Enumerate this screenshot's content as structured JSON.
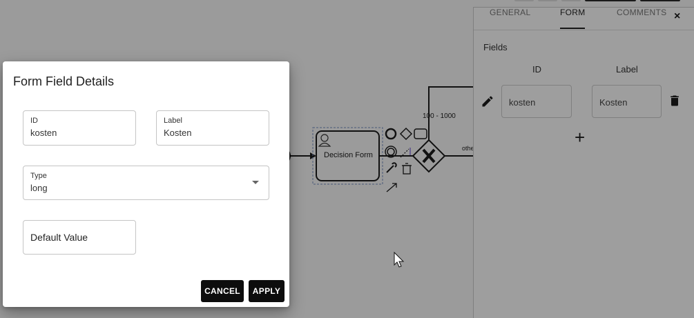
{
  "canvas": {
    "task_label": "Decision Form",
    "range_label": "100 - 1000",
    "other_label": "othe"
  },
  "panel": {
    "tabs": [
      {
        "label": "GENERAL"
      },
      {
        "label": "FORM"
      },
      {
        "label": "COMMENTS"
      }
    ],
    "active_tab": "FORM",
    "close_label": "×",
    "fields_heading": "Fields",
    "columns": {
      "id": "ID",
      "label": "Label"
    },
    "row": {
      "id_value": "kosten",
      "label_value": "Kosten"
    },
    "add_label": "+"
  },
  "dialog": {
    "title": "Form Field Details",
    "id_field": {
      "label": "ID",
      "value": "kosten"
    },
    "label_field": {
      "label": "Label",
      "value": "Kosten"
    },
    "type_field": {
      "label": "Type",
      "value": "long"
    },
    "default_field": {
      "placeholder": "Default Value"
    },
    "cancel_label": "CANCEL",
    "apply_label": "APPLY"
  },
  "colors": {
    "backdrop": "#9b9b9b",
    "dialog_bg": "#ffffff",
    "button_bg": "#0d0d0d"
  }
}
